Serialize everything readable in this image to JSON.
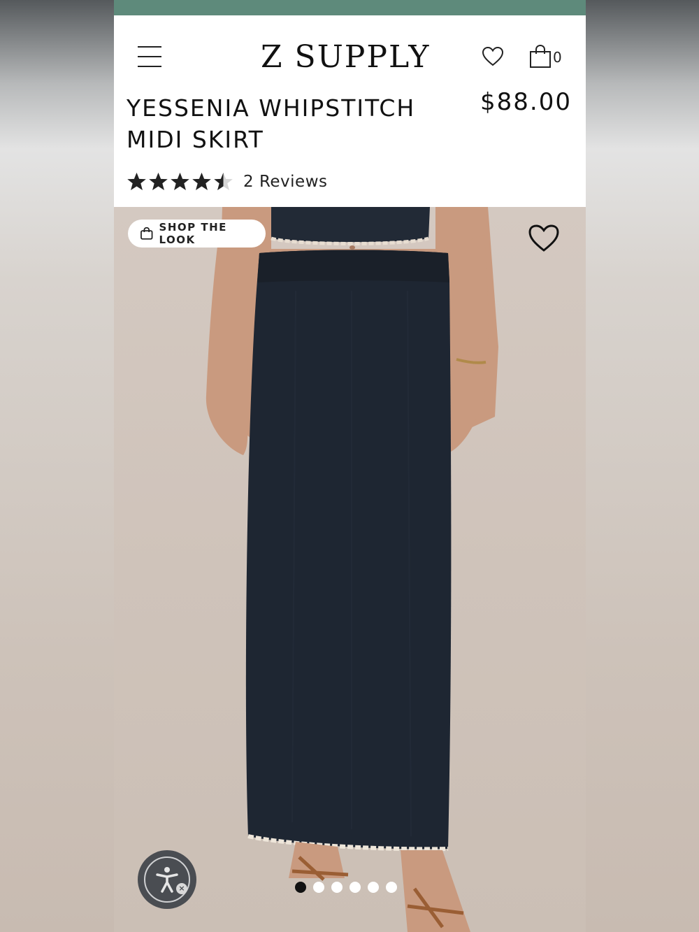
{
  "header": {
    "brand": "Z SUPPLY",
    "cart_count": "0",
    "icons": {
      "menu": "hamburger-icon",
      "wishlist": "heart-icon",
      "cart": "shopping-bag-icon"
    }
  },
  "product": {
    "title": "YESSENIA WHIPSTITCH MIDI SKIRT",
    "price": "$88.00",
    "rating": 4.5,
    "rating_max": 5,
    "reviews_label": "2 Reviews"
  },
  "hero": {
    "shop_the_look_label": "SHOP THE LOOK",
    "image_count": 6,
    "active_image": 1
  },
  "colors": {
    "accent_strip": "#5e8a7b",
    "text": "#111111",
    "skirt": "#1e2632"
  }
}
